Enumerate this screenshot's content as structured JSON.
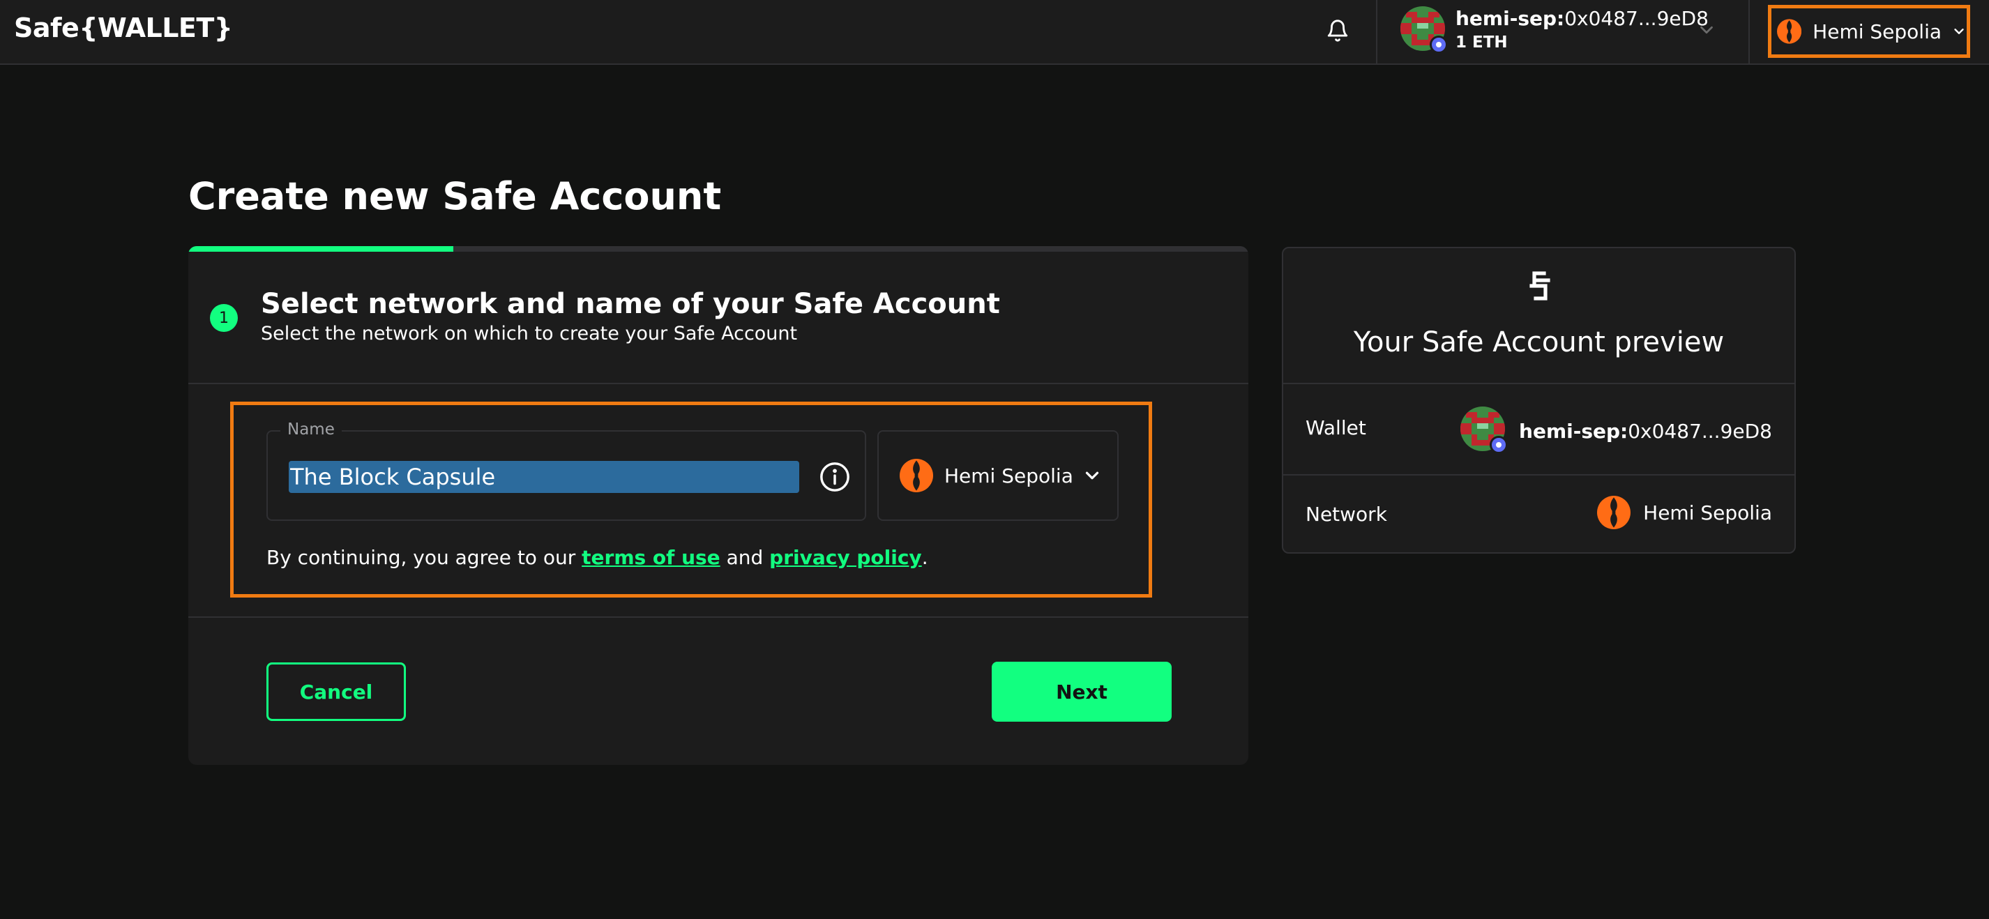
{
  "header": {
    "logo_text": "Safe{WALLET}",
    "account": {
      "prefix": "hemi-sep:",
      "address": "0x0487...9eD8",
      "balance": "1 ETH"
    },
    "network_selector": {
      "label": "Hemi Sepolia"
    }
  },
  "page": {
    "title": "Create new Safe Account"
  },
  "wizard": {
    "progress": 0.25,
    "step_number": "1",
    "step_title": "Select network and name of your Safe Account",
    "step_subtitle": "Select the network on which to create your Safe Account",
    "name_field": {
      "label": "Name",
      "value": "The Block Capsule"
    },
    "chain_select": {
      "label": "Hemi Sepolia"
    },
    "terms": {
      "before": "By continuing, you agree to our ",
      "terms_link": "terms of use",
      "middle": " and ",
      "privacy_link": "privacy policy",
      "after": "."
    },
    "cancel_label": "Cancel",
    "next_label": "Next"
  },
  "preview": {
    "title": "Your Safe Account preview",
    "wallet_label": "Wallet",
    "wallet_prefix": "hemi-sep:",
    "wallet_address": "0x0487...9eD8",
    "network_label": "Network",
    "network_value": "Hemi Sepolia"
  },
  "colors": {
    "background": "#121312",
    "surface": "#1c1c1c",
    "accent_green": "#12ff80",
    "highlight_orange": "#f07b12",
    "selection_blue": "#2c6b9d",
    "hemi_orange": "#ff6c15"
  },
  "icons": {
    "bell": "bell-icon",
    "chevron": "chevron-down-icon",
    "info": "info-icon",
    "hemi": "hemi-logo-icon",
    "safe": "safe-logo-icon"
  }
}
